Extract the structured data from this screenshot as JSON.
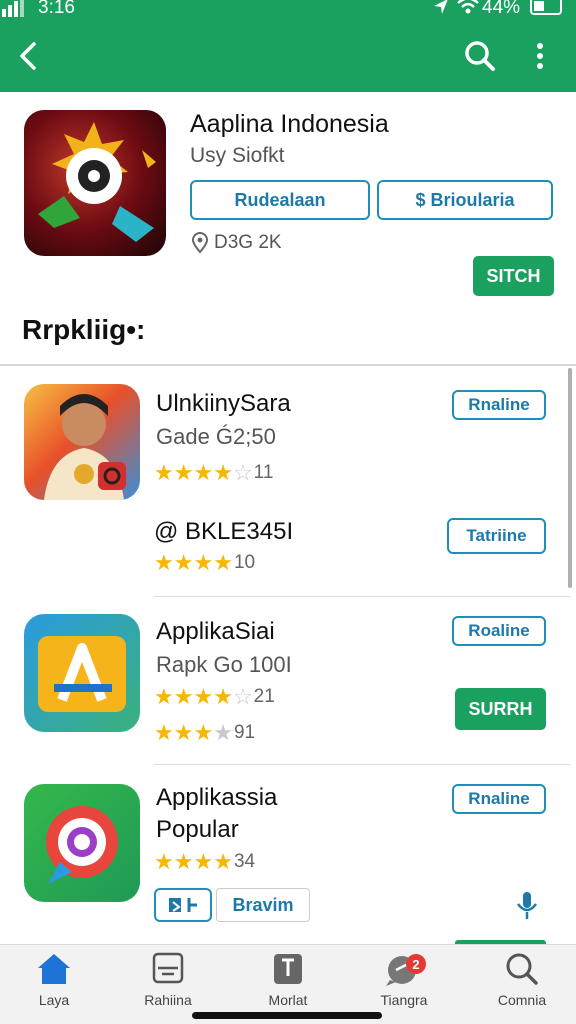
{
  "status": {
    "time": "3:16",
    "battery": "44%"
  },
  "colors": {
    "brand": "#1aa160",
    "accent": "#1d8fb8",
    "star": "#f6b700"
  },
  "appbar": {
    "back_icon": "back-arrow-icon",
    "search_icon": "search-icon",
    "menu_icon": "more-vertical-icon"
  },
  "featured": {
    "title": "Aaplina Indonesia",
    "developer": "Usy Siofkt",
    "btn1": "Rudealaan",
    "btn2": "$ Brioularia",
    "downloads": "D3G 2K",
    "action": "SITCH"
  },
  "section_title": "Rrpkliig•:",
  "apps": [
    {
      "title": "UlnkiinySara",
      "subtitle": "Gade Ǵ2;50",
      "rating_value": 4,
      "rating_count": "11",
      "tag": "Rnaline"
    },
    {
      "title": "@ BKLE345I",
      "rating_value": 4,
      "rating_count": "10",
      "tag": "Tatriine"
    },
    {
      "title": "ApplikaSiai",
      "subtitle": "Rapk Go 100I",
      "rating_value": 4,
      "rating_count": "21",
      "rating_value2": 3,
      "rating_count2": "91",
      "tag": "Roaline",
      "action": "SURRH"
    },
    {
      "title": "Applikassia",
      "title2": "Popular",
      "rating_value": 4,
      "rating_count": "34",
      "tag": "Rnaline",
      "chip1": "Bravim"
    }
  ],
  "bottom_nav": [
    {
      "label": "Laya",
      "icon": "home-icon"
    },
    {
      "label": "Rahiina",
      "icon": "library-icon"
    },
    {
      "label": "Morlat",
      "icon": "bookmark-icon"
    },
    {
      "label": "Tiangra",
      "icon": "chat-icon",
      "badge": "2"
    },
    {
      "label": "Comnia",
      "icon": "search-icon"
    }
  ]
}
